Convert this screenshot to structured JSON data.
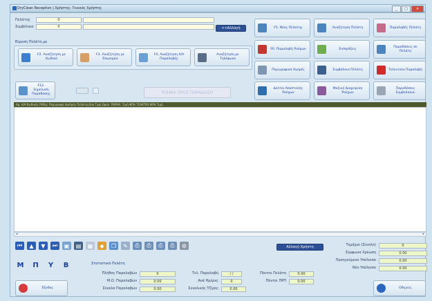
{
  "window": {
    "title": "DryClean Reception | Χρήστης: Γενικός Χρήστης"
  },
  "customer": {
    "client_label": "Πελάτης",
    "client_value": "0",
    "discount_label": "Συμβόλαιο",
    "discount_value": "0",
    "change_button": "<<Αλλαγή"
  },
  "search": {
    "title": "Εύρεση Πελάτη με",
    "buttons": [
      {
        "label": "F2. Αναζήτηση με Κωδικό",
        "icon": "magnifier-icon"
      },
      {
        "label": "F3. Αναζήτηση με Επωνυμία",
        "icon": "person-icon"
      },
      {
        "label": "F4. Αναζήτηση Α/Α Παραλαβής",
        "icon": "document-icon"
      },
      {
        "label": "Αναζήτηση με Τηλέφωνο",
        "icon": "phone-icon"
      }
    ]
  },
  "actions": [
    {
      "label": "F5. Νέος Πελάτης",
      "icon": "new-customer-icon"
    },
    {
      "label": "Αναζήτηση Πελάτη",
      "icon": "find-customer-icon"
    },
    {
      "label": "Παραλαβές Πελάτη",
      "icon": "customer-receipts-icon"
    },
    {
      "label": "F6. Παραλαβή Ρούχων",
      "icon": "receive-clothes-icon"
    },
    {
      "label": "Εισπράξεις",
      "icon": "payments-icon"
    },
    {
      "label": "Παραδόσεις σε Πελάτη",
      "icon": "deliveries-icon"
    },
    {
      "label": "Περιγραφικά Αγορές",
      "icon": "purchases-icon"
    },
    {
      "label": "Συμβόλαια Πελάτη",
      "icon": "contracts-icon"
    },
    {
      "label": "Τελευταία Παραλαβή",
      "icon": "last-receipt-icon"
    },
    {
      "label": "Δελτίο Αποστολής Ρούχων",
      "icon": "dispatch-note-icon"
    },
    {
      "label": "Μαζική Διαχείριση Ρούχων",
      "icon": "bulk-clothes-icon"
    },
    {
      "label": "Παραδόσεις Συμβολαίων",
      "icon": "contract-deliveries-icon"
    }
  ],
  "delivery": {
    "button": "F12. Σημείωση Παράδοσης",
    "flow_label": "ΡΟΗΚΑ ΠΡΟΣ ΠΑΡΑΔΟΣΗ"
  },
  "grid": {
    "header": "Αρ. Α/Α  Κωδικός Ρόδης          Περιγραφή  Αριθμός  Πελάτης/Ισο  Τιμή  Ωρολ.  ΠΑΡΑΛ.   Τιμή   ΦΠΑ  ΤΣΑΚΤΡΩ  ΦΠΑ  Τιμή"
  },
  "toolbar": {
    "show_button": "Αλλαγή Χρήστη",
    "letters": [
      "M",
      "Π",
      "Y",
      "B"
    ]
  },
  "stats": {
    "title": "Στατιστικά Πελάτη",
    "rows": [
      {
        "label": "Πλήθος Παραλαβών",
        "value": "0"
      },
      {
        "label": "Μ.Ο. Παραλαβών",
        "value": "0.00"
      },
      {
        "label": "Σύνολο Παραλαβών",
        "value": "0.00"
      }
    ],
    "mid": [
      {
        "label": "Τελ. Παραλαβή",
        "value": "/ /"
      },
      {
        "label": "Ανά Ημέρες",
        "value": "0"
      },
      {
        "label": "Συνολικός Τζίρος",
        "value": "0.00"
      }
    ],
    "right": [
      {
        "label": "Πόντοι Πελάτη",
        "value": "0.00"
      },
      {
        "label": "Πόντοι ΠΡΠ",
        "value": "0.00"
      }
    ]
  },
  "summary": [
    {
      "label": "Τεμάχια (Σύνολο)",
      "value": "0"
    },
    {
      "label": "Σύμφωνα Χρέωση",
      "value": "0.00"
    },
    {
      "label": "Προηγούμενο Υπόλοιπο",
      "value": "0.00"
    },
    {
      "label": "Νέο Υπόλοιπο",
      "value": "0.00"
    }
  ],
  "footer": {
    "exit_button": "Έξοδος",
    "help_button": "Οδηγίες"
  }
}
